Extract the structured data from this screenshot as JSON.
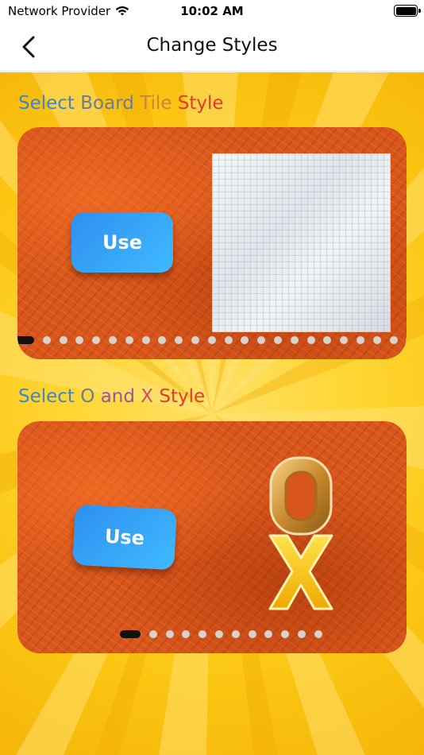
{
  "status_bar": {
    "carrier": "Network Provider",
    "time": "10:02 AM",
    "wifi_icon": "wifi-icon",
    "battery_icon": "battery-icon"
  },
  "nav": {
    "title": "Change Styles",
    "back_icon": "chevron-left-icon"
  },
  "board_tile_section": {
    "title_words": [
      "Select",
      "Board",
      "Tile",
      "Style"
    ],
    "use_label": "Use",
    "page_count": 24,
    "active_page": 0
  },
  "ox_section": {
    "title_words": [
      "Select",
      "O",
      "and",
      "X",
      "Style"
    ],
    "use_label": "Use",
    "preview_letters": [
      "O",
      "X"
    ],
    "page_count": 12,
    "active_page": 0
  },
  "colors": {
    "background_yellow": "#fbc512",
    "card_orange": "#d8561c",
    "button_blue": "#2e8ff0",
    "title_blue": "#3f86c8",
    "title_red": "#e23a2c",
    "dot_active": "#111111",
    "dot_inactive": "#d7d2cc"
  }
}
